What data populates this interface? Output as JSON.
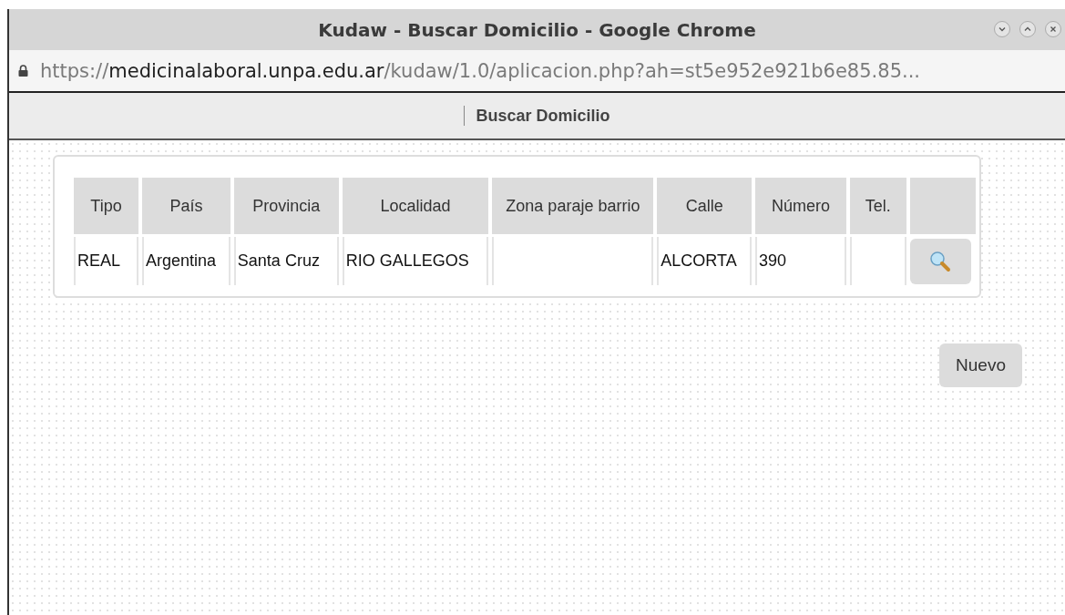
{
  "window": {
    "title": "Kudaw - Buscar Domicilio - Google Chrome"
  },
  "address_bar": {
    "scheme": "https://",
    "host": "medicinalaboral.unpa.edu.ar",
    "path": "/kudaw/1.0/aplicacion.php?ah=st5e952e921b6e85.85..."
  },
  "page_header": {
    "title": "Buscar Domicilio"
  },
  "table": {
    "columns": [
      "Tipo",
      "País",
      "Provincia",
      "Localidad",
      "Zona paraje barrio",
      "Calle",
      "Número",
      "Tel."
    ],
    "rows": [
      {
        "cells": [
          "REAL",
          "Argentina",
          "Santa Cruz",
          "RIO GALLEGOS",
          "",
          "ALCORTA",
          "390",
          ""
        ]
      }
    ]
  },
  "buttons": [
    "Nuevo"
  ]
}
